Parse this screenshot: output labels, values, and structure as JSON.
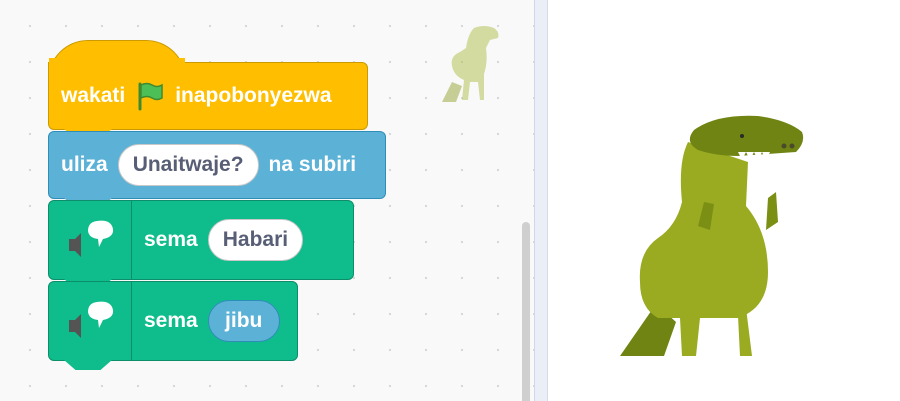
{
  "script": {
    "hat_block": {
      "label_before": "wakati",
      "icon": "green-flag-icon",
      "label_after": "inapobonyezwa"
    },
    "ask_block": {
      "label_before": "uliza",
      "question": "Unaitwaje?",
      "label_after": "na subiri"
    },
    "say_blocks": [
      {
        "label": "sema",
        "value": "Habari",
        "icon": "speech-bubble-icon"
      },
      {
        "label": "sema",
        "value": "jibu",
        "icon": "speech-bubble-icon"
      }
    ]
  },
  "sprite": {
    "name_icon": "dinosaur-icon"
  },
  "colors": {
    "events": "#ffbf00",
    "sensing": "#5cb1d6",
    "extension": "#0fbd8c",
    "dino_light": "#9aab22",
    "dino_dark": "#6f8412"
  }
}
